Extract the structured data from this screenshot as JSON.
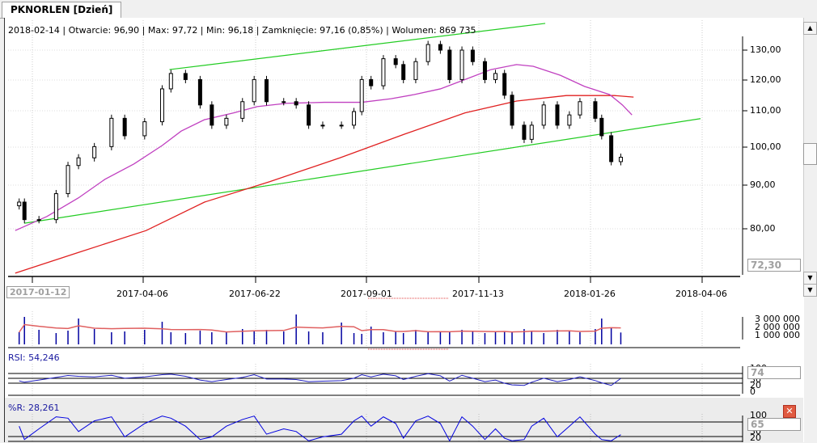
{
  "tab": {
    "title": "PKNORLEN [Dzień]"
  },
  "info": "2018-02-14 | Otwarcie: 96,90 | Max: 97,72 | Min: 96,18 | Zamknięcie: 97,16 (0,85%)  | Wolumen: 869 735",
  "price_axis": {
    "ticks": [
      "130,00",
      "120,00",
      "110,00",
      "100,00",
      "90,00",
      "80,00"
    ],
    "current_box": "72,30",
    "scale": "log"
  },
  "date_axis": {
    "ticks": [
      "2017-01-12",
      "2017-04-06",
      "2017-06-22",
      "2017-09-01",
      "2017-11-13",
      "2018-01-26",
      "2018-04-06"
    ]
  },
  "volume_axis": {
    "ticks": [
      "3 000 000",
      "2 000 000",
      "1 000 000"
    ]
  },
  "rsi": {
    "label": "RSI: 54,246",
    "ticks": [
      "100",
      "30",
      "20",
      "0"
    ],
    "box": "74"
  },
  "wr": {
    "label": "%R: 28,261",
    "ticks": [
      "100",
      "30",
      "20"
    ],
    "box": "65"
  },
  "colors": {
    "candle": "#000000",
    "ma_short": "#c040c0",
    "ma_long": "#e02020",
    "trendline": "#22cc22",
    "volume": "#0000a0",
    "volume_ma": "#e06060",
    "rsi": "#2020c0"
  },
  "chart_data": {
    "type": "candlestick",
    "dates": [
      "2017-01-02",
      "2017-01-06",
      "2017-01-17",
      "2017-01-30",
      "2017-02-08",
      "2017-02-16",
      "2017-02-28",
      "2017-03-13",
      "2017-03-23",
      "2017-04-07",
      "2017-04-19",
      "2017-04-25",
      "2017-05-05",
      "2017-05-15",
      "2017-05-23",
      "2017-06-02",
      "2017-06-13",
      "2017-06-21",
      "2017-06-29",
      "2017-07-10",
      "2017-07-18",
      "2017-07-26",
      "2017-08-04",
      "2017-08-16",
      "2017-08-24",
      "2017-08-29",
      "2017-09-04",
      "2017-09-12",
      "2017-09-20",
      "2017-09-25",
      "2017-10-03",
      "2017-10-11",
      "2017-10-19",
      "2017-10-25",
      "2017-11-02",
      "2017-11-09",
      "2017-11-17",
      "2017-11-24",
      "2017-11-30",
      "2017-12-05",
      "2017-12-13",
      "2017-12-18",
      "2017-12-26",
      "2018-01-04",
      "2018-01-12",
      "2018-01-19",
      "2018-01-29",
      "2018-02-02",
      "2018-02-08",
      "2018-02-14"
    ],
    "close": [
      86,
      82,
      82,
      88,
      95,
      97,
      100,
      108,
      103,
      107,
      117,
      122,
      120,
      112,
      106,
      108,
      113,
      120,
      113,
      113,
      112,
      106,
      106,
      106,
      110,
      120,
      118,
      127,
      125,
      120,
      126,
      132,
      130,
      120,
      130,
      126,
      120,
      122,
      115,
      106,
      102,
      106,
      112,
      106,
      109,
      113,
      108,
      103,
      96,
      97.16
    ],
    "volume": [
      900000,
      2800000,
      1200000,
      800000,
      1100000,
      2600000,
      1300000,
      900000,
      1000000,
      1200000,
      2200000,
      900000,
      800000,
      1100000,
      900000,
      1000000,
      1300000,
      1100000,
      1200000,
      1000000,
      3100000,
      1000000,
      900000,
      2100000,
      800000,
      700000,
      1600000,
      900000,
      1000000,
      800000,
      1200000,
      900000,
      1000000,
      900000,
      1200000,
      1100000,
      800000,
      900000,
      1000000,
      900000,
      1300000,
      1100000,
      800000,
      1200000,
      1000000,
      900000,
      1300000,
      2600000,
      1500000,
      869735
    ],
    "rsi": [
      45,
      40,
      48,
      58,
      65,
      62,
      60,
      66,
      55,
      60,
      68,
      70,
      62,
      48,
      42,
      50,
      58,
      68,
      52,
      52,
      50,
      42,
      44,
      46,
      55,
      68,
      60,
      70,
      64,
      50,
      62,
      72,
      64,
      44,
      66,
      55,
      42,
      48,
      36,
      30,
      28,
      40,
      55,
      42,
      50,
      60,
      46,
      38,
      28,
      54.246
    ],
    "wr": [
      60,
      10,
      50,
      95,
      90,
      40,
      80,
      95,
      20,
      70,
      98,
      90,
      60,
      10,
      20,
      60,
      85,
      98,
      30,
      50,
      40,
      5,
      20,
      30,
      80,
      98,
      60,
      95,
      70,
      15,
      80,
      98,
      70,
      5,
      95,
      60,
      10,
      50,
      15,
      5,
      10,
      60,
      90,
      20,
      60,
      95,
      30,
      10,
      5,
      28.261
    ],
    "ma_short": {
      "dates": [
        "2016-12-30",
        "2017-01-23",
        "2017-02-16",
        "2017-03-08",
        "2017-03-30",
        "2017-04-19",
        "2017-05-02",
        "2017-05-18",
        "2017-06-07",
        "2017-06-23",
        "2017-07-12",
        "2017-08-05",
        "2017-08-29",
        "2017-09-17",
        "2017-10-02",
        "2017-10-19",
        "2017-11-04",
        "2017-11-21",
        "2017-12-08",
        "2017-12-19",
        "2018-01-06",
        "2018-01-22",
        "2018-02-07",
        "2018-02-15",
        "2018-02-21"
      ],
      "values": [
        79.6,
        82.7,
        87.0,
        91.5,
        95.4,
        100.3,
        104.3,
        107.6,
        109.6,
        111.5,
        112.5,
        112.8,
        112.8,
        113.9,
        115.2,
        117.0,
        120.0,
        123.3,
        125.0,
        124.4,
        121.4,
        117.8,
        115.2,
        112.0,
        109.0
      ]
    },
    "ma_long": {
      "dates": [
        "2016-12-30",
        "2017-02-16",
        "2017-04-08",
        "2017-05-18",
        "2017-07-01",
        "2017-08-15",
        "2017-09-26",
        "2017-11-04",
        "2017-12-08",
        "2018-01-10",
        "2018-02-10",
        "2018-02-22"
      ],
      "values": [
        70.9,
        75.0,
        79.6,
        86.0,
        90.9,
        97.0,
        103.5,
        109.6,
        113.2,
        114.9,
        114.9,
        114.4
      ]
    },
    "trendlines": [
      {
        "from": [
          "2017-04-24",
          123.3
        ],
        "to": [
          "2017-12-27",
          139.8
        ]
      },
      {
        "from": [
          "2017-01-06",
          81.2
        ],
        "to": [
          "2018-04-05",
          107.9
        ]
      }
    ],
    "ylim": [
      70.6,
      141
    ]
  }
}
